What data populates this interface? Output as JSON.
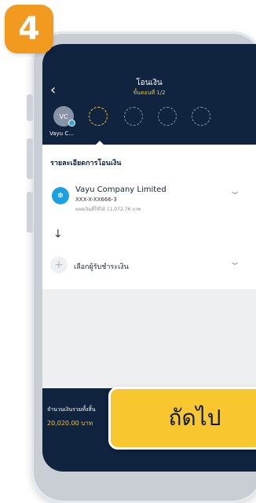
{
  "step": {
    "number": "4"
  },
  "header": {
    "back_icon": "back-arrow-icon",
    "title": "โอนเงิน",
    "subtitle": "ขั้นตอนที่ 1/2"
  },
  "recipients": {
    "selected": {
      "initials": "VC",
      "name": "Vayu C..."
    },
    "empty_slots": 4
  },
  "details": {
    "section_title": "รายละเอียดการโอนเงิน",
    "account": {
      "bank_icon": "bank-logo-icon",
      "name": "Vayu Company Limited",
      "number": "XXX-X-XX666-3",
      "note": "ยอดเงินที่ใช้ได้ 11,072.76 บาท"
    },
    "payer_label": "เลือกผู้รับชำระเงิน"
  },
  "footer": {
    "total_label": "จำนวนเงินรวมทั้งสิ้น",
    "total_value": "20,020.00 บาท",
    "next_label": "ถัดไป"
  },
  "colors": {
    "navy": "#10233F",
    "accent_yellow": "#F8C62E",
    "badge_orange": "#F29A20"
  }
}
